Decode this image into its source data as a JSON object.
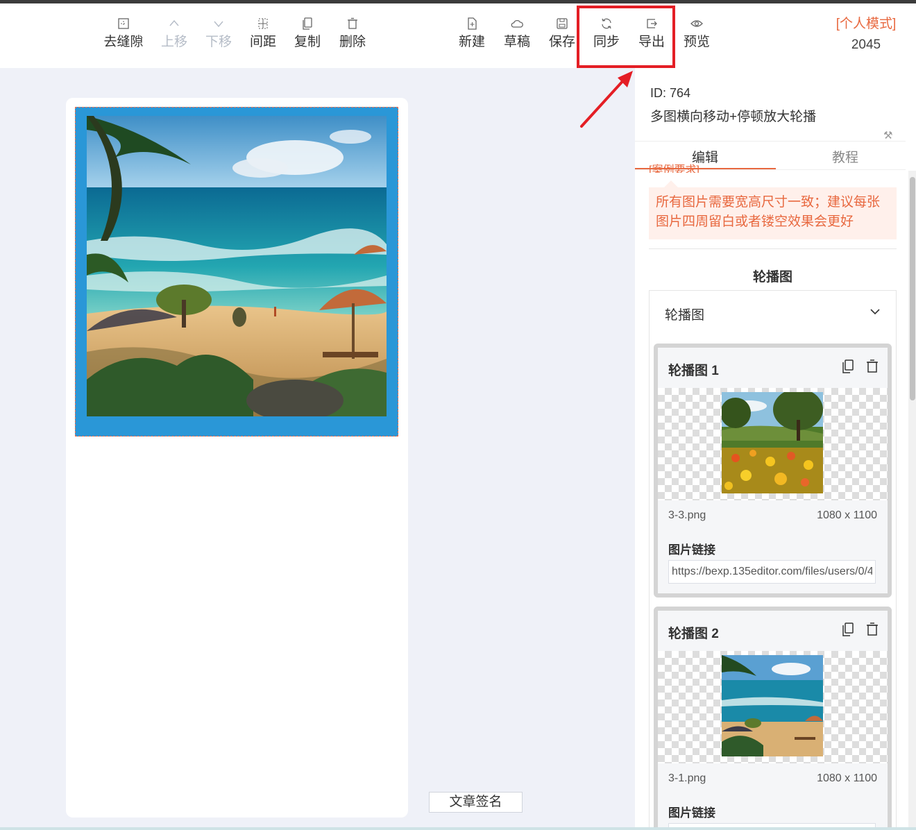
{
  "toolbar": {
    "left_buttons": [
      {
        "label": "去缝隙",
        "icon": "gap-icon",
        "disabled": false
      },
      {
        "label": "上移",
        "icon": "chevron-up-icon",
        "disabled": true
      },
      {
        "label": "下移",
        "icon": "chevron-down-icon",
        "disabled": true
      },
      {
        "label": "间距",
        "icon": "spacing-icon",
        "disabled": false
      },
      {
        "label": "复制",
        "icon": "copy-icon",
        "disabled": false
      },
      {
        "label": "删除",
        "icon": "trash-icon",
        "disabled": false
      }
    ],
    "right_buttons": [
      {
        "label": "新建",
        "icon": "new-file-icon"
      },
      {
        "label": "草稿",
        "icon": "cloud-icon"
      },
      {
        "label": "保存",
        "icon": "save-icon"
      },
      {
        "label": "同步",
        "icon": "sync-icon"
      },
      {
        "label": "导出",
        "icon": "export-icon"
      },
      {
        "label": "预览",
        "icon": "eye-icon"
      }
    ],
    "mode": "[个人模式]",
    "number": "2045"
  },
  "canvas": {
    "signature_button": "文章签名"
  },
  "panel": {
    "id_text": "ID: 764",
    "title": "多图横向移动+停顿放大轮播",
    "tabs": [
      "编辑",
      "教程"
    ],
    "cut_text": "[案例要求]",
    "notice": "所有图片需要宽高尺寸一致；建议每张图片四周留白或者镂空效果会更好",
    "section_title": "轮播图",
    "collapse_title": "轮播图",
    "items": [
      {
        "title": "轮播图 1",
        "filename": "3-3.png",
        "size": "1080 x 1100",
        "link_label": "图片链接",
        "link_value": "https://bexp.135editor.com/files/users/0/4"
      },
      {
        "title": "轮播图 2",
        "filename": "3-1.png",
        "size": "1080 x 1100",
        "link_label": "图片链接",
        "link_value": ""
      }
    ]
  },
  "colors": {
    "accent": "#e8683f",
    "highlight_box": "#e41e25",
    "frame_blue": "#2a97d7"
  }
}
